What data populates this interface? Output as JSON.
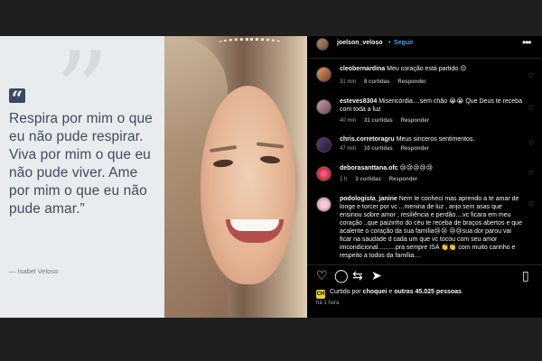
{
  "quote": {
    "mark": "“",
    "text": "Respira por mim o que eu não pude respirar. Viva por mim o que eu não pude viver. Ame por mim o que eu não pude amar.”",
    "author": "— Isabel Veloso"
  },
  "header": {
    "username": "joelson_veloso",
    "separator": "•",
    "follow_label": "Seguir",
    "more_glyph": "•••"
  },
  "comments": [
    {
      "username": "cleobernardina",
      "text": "Meu coração está partido 😔",
      "time": "31 min",
      "likes": "8 curtidas",
      "reply": "Responder"
    },
    {
      "username": "esteves8304",
      "text": "Misericórdia....sem chão 😭😭 Que Deus te receba com toda a luz",
      "time": "40 min",
      "likes": "31 curtidas",
      "reply": "Responder"
    },
    {
      "username": "chris.corretoragru",
      "text": "Meus sinceros sentimentos.",
      "time": "47 min",
      "likes": "10 curtidas",
      "reply": "Responder"
    },
    {
      "username": "deborasanttana.ofc",
      "text": "😢😢😢😢😢",
      "time": "1 h",
      "likes": "3 curtidas",
      "reply": "Responder"
    },
    {
      "username": "podologista_janine",
      "text": "Nem te conheci mas aprendo a te amar de longe e torcer por vc ...menina de luz , anjo sem asas que ensinou sobre amor , resiliência e perdão....vc ficara em meu coração ..que paizinho do céu te receba de braços abertos e que acalente o coração da sua família😢😢 😢😢sua dor parou vai ficar na saudade d cada um que vc tocou com seu amor imcondicional..........pra sempre ISA 👏👏 com muito carinho e respeito a todos da família....",
      "time": "",
      "likes": "",
      "reply": ""
    }
  ],
  "actions": {
    "like_icon": "heart-icon",
    "comment_icon": "comment-icon",
    "share_icon": "share-icon",
    "send_icon": "send-icon",
    "save_icon": "bookmark-icon"
  },
  "likes": {
    "prefix": "Curtido por",
    "user": "choquei",
    "middle": "e",
    "others": "outras 45.025 pessoas",
    "badge": "CH"
  },
  "time_ago": "há 1 hora",
  "colors": {
    "link": "#4d9be6",
    "background": "#000000",
    "quote_panel": "#e9ecef",
    "quote_text": "#3e4c5d"
  }
}
